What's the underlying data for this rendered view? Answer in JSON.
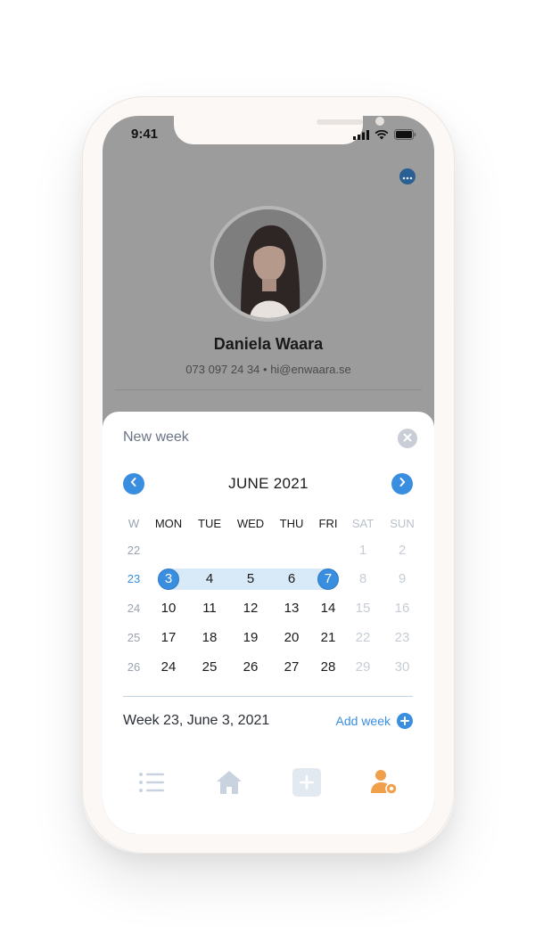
{
  "status_bar": {
    "time": "9:41"
  },
  "profile": {
    "name": "Daniela Waara",
    "contact": "073 097 24 34 • hi@enwaara.se"
  },
  "sheet": {
    "title": "New week",
    "calendar": {
      "month_label": "JUNE 2021",
      "headers": {
        "week": "W",
        "mon": "MON",
        "tue": "TUE",
        "wed": "WED",
        "thu": "THU",
        "fri": "FRI",
        "sat": "SAT",
        "sun": "SUN"
      },
      "rows": [
        {
          "week": "22",
          "days": [
            "",
            "",
            "",
            "",
            "",
            "1",
            "2"
          ]
        },
        {
          "week": "23",
          "days": [
            "3",
            "4",
            "5",
            "6",
            "7",
            "8",
            "9"
          ]
        },
        {
          "week": "24",
          "days": [
            "10",
            "11",
            "12",
            "13",
            "14",
            "15",
            "16"
          ]
        },
        {
          "week": "25",
          "days": [
            "17",
            "18",
            "19",
            "20",
            "21",
            "22",
            "23"
          ]
        },
        {
          "week": "26",
          "days": [
            "24",
            "25",
            "26",
            "27",
            "28",
            "29",
            "30"
          ]
        }
      ],
      "selected_week": "23",
      "selected_range": [
        "3",
        "7"
      ]
    },
    "summary": "Week 23, June 3, 2021",
    "add_week_label": "Add week"
  },
  "tabbar": {
    "items": [
      {
        "icon": "list-icon"
      },
      {
        "icon": "home-icon"
      },
      {
        "icon": "plus-square-icon"
      },
      {
        "icon": "user-settings-icon",
        "active": true
      }
    ]
  },
  "colors": {
    "accent": "#3a8ee0",
    "active_tab": "#f0a04b",
    "inactive_tab": "#c9d3df",
    "overlay": "#9c9c9c"
  }
}
